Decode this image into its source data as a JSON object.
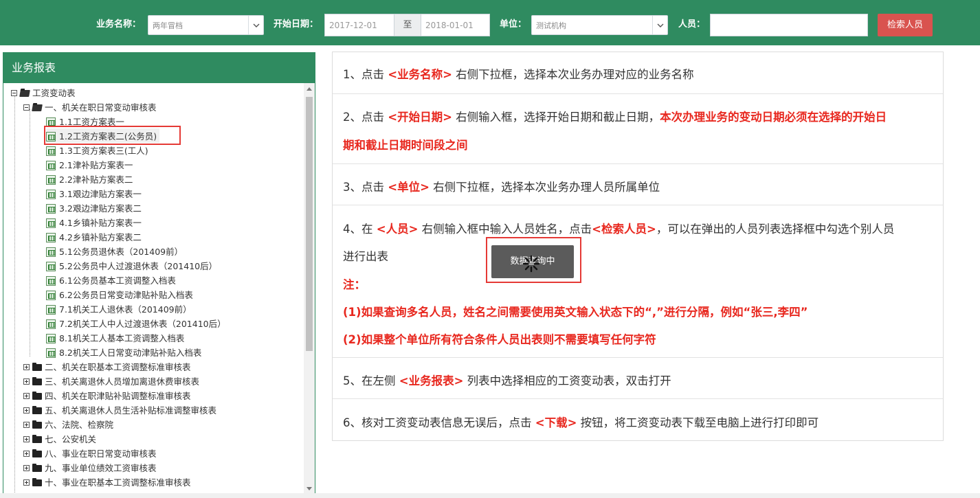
{
  "toolbar": {
    "business_label": "业务名称：",
    "business_value": "两年冒档",
    "start_date_label": "开始日期：",
    "start_date_value": "2017-12-01",
    "to_label": "至",
    "end_date_value": "2018-01-01",
    "unit_label": "单位：",
    "unit_value": "测试机构",
    "person_label": "人员：",
    "person_value": "",
    "search_button": "检索人员",
    "bar_color": "#2f8b60",
    "button_color": "#d9534f"
  },
  "panel": {
    "title": "业务报表"
  },
  "tree": {
    "root": "工资变动表",
    "group1": "一、机关在职日常变动审核表",
    "leaves": [
      "1.1工资方案表一",
      "1.2工资方案表二(公务员)",
      "1.3工资方案表三(工人)",
      "2.1津补贴方案表一",
      "2.2津补贴方案表二",
      "3.1艰边津贴方案表一",
      "3.2艰边津贴方案表二",
      "4.1乡镇补贴方案表一",
      "4.2乡镇补贴方案表二",
      "5.1公务员退休表（201409前）",
      "5.2公务员中人过渡退休表（201410后）",
      "6.1公务员基本工资调整入档表",
      "6.2公务员日常变动津贴补贴入档表",
      "7.1机关工人退休表（201409前）",
      "7.2机关工人中人过渡退休表（201410后）",
      "8.1机关工人基本工资调整入档表",
      "8.2机关工人日常变动津贴补贴入档表"
    ],
    "groups": [
      "二、机关在职基本工资调整标准审核表",
      "三、机关离退休人员增加离退休费审核表",
      "四、机关在职津贴补贴调整标准审核表",
      "五、机关离退休人员生活补贴标准调整审核表",
      "六、法院、检察院",
      "七、公安机关",
      "八、事业在职日常变动审核表",
      "九、事业单位绩效工资审核表",
      "十、事业在职基本工资调整标准审核表"
    ]
  },
  "steps": {
    "s1": {
      "a": "1、点击 ",
      "b": "<业务名称>",
      "c": " 右侧下拉框，选择本次业务办理对应的业务名称"
    },
    "s2": {
      "a": "2、点击 ",
      "b": "<开始日期>",
      "c": " 右侧输入框，选择开始日期和截止日期，",
      "d": "本次办理业务的变动日期必须在选择的开始日",
      "e": "期和截止日期时间段之间"
    },
    "s3": {
      "a": "3、点击 ",
      "b": "<单位>",
      "c": " 右侧下拉框，选择本次业务办理人员所属单位"
    },
    "s4": {
      "a": "4、在 ",
      "b": "<人员>",
      "c": " 右侧输入框中输入人员姓名，点击",
      "d": "<检索人员>",
      "e": "，可以在弹出的人员列表选择框中勾选个别人员",
      "f": "进行出表",
      "note": "注：",
      "n1": "(1)如果查询多名人员，姓名之间需要使用英文输入状态下的“,”进行分隔，例如“张三,李四”",
      "n2": "(2)如果整个单位所有符合条件人员出表则不需要填写任何字符"
    },
    "s5": {
      "a": "5、在左侧 ",
      "b": "<业务报表>",
      "c": " 列表中选择相应的工资变动表，双击打开"
    },
    "s6": {
      "a": "6、核对工资变动表信息无误后，点击 ",
      "b": "<下载>",
      "c": " 按钮，将工资变动表下载至电脑上进行打印即可"
    }
  },
  "loading": {
    "text": "数据查询中",
    "icon": "spinner-icon"
  }
}
